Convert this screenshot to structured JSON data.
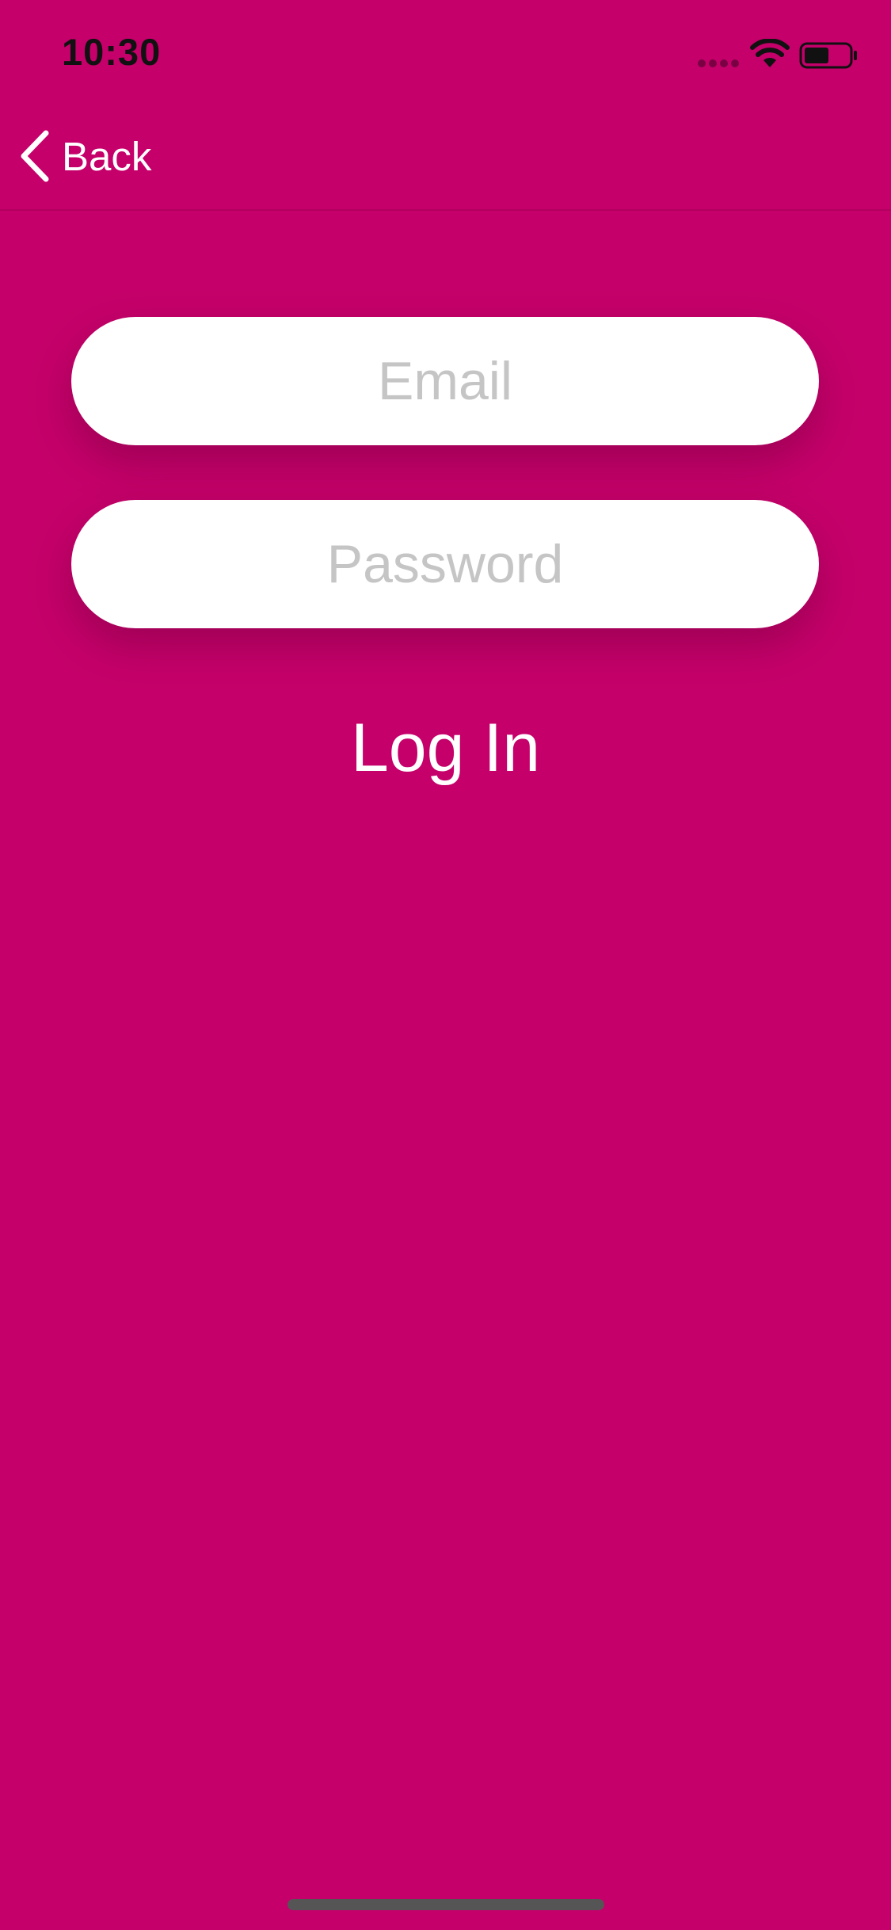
{
  "status_bar": {
    "time": "10:30"
  },
  "nav": {
    "back_label": "Back"
  },
  "form": {
    "email": {
      "placeholder": "Email",
      "value": ""
    },
    "password": {
      "placeholder": "Password",
      "value": ""
    },
    "login_label": "Log In"
  },
  "colors": {
    "background": "#c5006a",
    "field_background": "#ffffff",
    "placeholder": "#c5c5c5",
    "text": "#ffffff"
  },
  "icons": {
    "back": "chevron-left-icon",
    "signal": "cellular-signal-icon",
    "wifi": "wifi-icon",
    "battery": "battery-icon"
  }
}
